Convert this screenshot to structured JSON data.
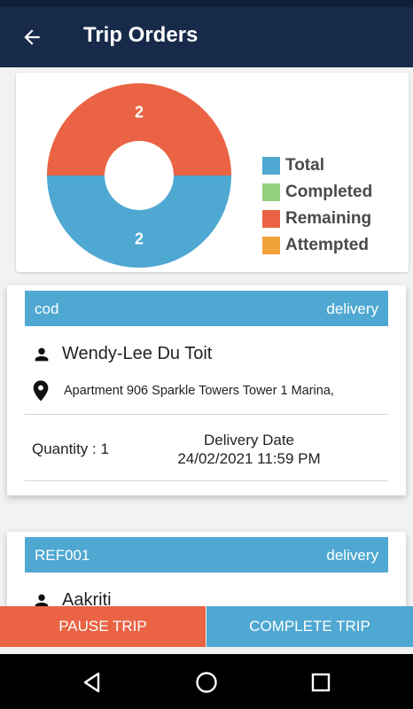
{
  "app_bar": {
    "title": "Trip Orders",
    "back_icon": "arrow-left-icon",
    "background": "#172a4a"
  },
  "chart_data": {
    "type": "pie",
    "slices": [
      {
        "name": "Remaining",
        "value": 2,
        "color": "#ea6344"
      },
      {
        "name": "Total",
        "value": 2,
        "color": "#4fa8d2"
      }
    ],
    "legend": [
      {
        "label": "Total",
        "color": "#4fa8d2"
      },
      {
        "label": "Completed",
        "color": "#93d07e"
      },
      {
        "label": "Remaining",
        "color": "#ea6344"
      },
      {
        "label": "Attempted",
        "color": "#f2a23b"
      }
    ],
    "legend_position": "right",
    "donut": true
  },
  "orders": [
    {
      "reference": "cod",
      "type": "delivery",
      "customer": "Wendy-Lee Du Toit",
      "address": "Apartment 906 Sparkle Towers Tower 1 Marina,",
      "quantity": "Quantity : 1",
      "delivery_date_label": "Delivery Date",
      "delivery_date": "24/02/2021 11:59 PM"
    },
    {
      "reference": "REF001",
      "type": "delivery",
      "customer": "Aakriti"
    }
  ],
  "actions": {
    "pause": "PAUSE TRIP",
    "complete": "COMPLETE TRIP"
  },
  "colors": {
    "accent_blue": "#4fa8d2",
    "accent_red": "#ea6344"
  },
  "nav_icons": [
    "back-triangle-icon",
    "home-circle-icon",
    "recents-square-icon"
  ]
}
